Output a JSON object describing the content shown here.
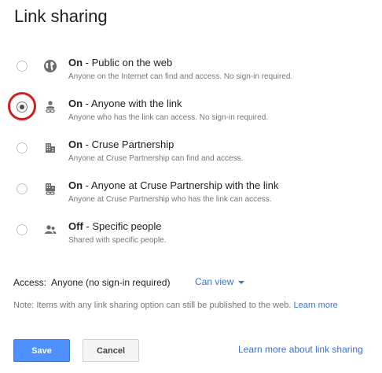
{
  "dialog": {
    "title": "Link sharing"
  },
  "options": [
    {
      "state": "On",
      "separator": " - ",
      "label": "Public on the web",
      "description": "Anyone on the Internet can find and access. No sign-in required.",
      "icon": "globe-icon",
      "selected": false
    },
    {
      "state": "On",
      "separator": " - ",
      "label": "Anyone with the link",
      "description": "Anyone who has the link can access. No sign-in required.",
      "icon": "person-link-icon",
      "selected": true
    },
    {
      "state": "On",
      "separator": " - ",
      "label": "Cruse Partnership",
      "description": "Anyone at Cruse Partnership can find and access.",
      "icon": "building-icon",
      "selected": false
    },
    {
      "state": "On",
      "separator": " - ",
      "label": "Anyone at Cruse Partnership with the link",
      "description": "Anyone at Cruse Partnership who has the link can access.",
      "icon": "building-link-icon",
      "selected": false
    },
    {
      "state": "Off",
      "separator": " - ",
      "label": "Specific people",
      "description": "Shared with specific people.",
      "icon": "people-icon",
      "selected": false
    }
  ],
  "access": {
    "label": "Access:",
    "value": "Anyone (no sign-in required)",
    "permission": "Can view"
  },
  "note": {
    "text": "Note: Items with any link sharing option can still be published to the web.",
    "link": "Learn more"
  },
  "buttons": {
    "save": "Save",
    "cancel": "Cancel"
  },
  "footer_link": "Learn more about link sharing",
  "colors": {
    "accent": "#4d90fe",
    "link": "#3a6fd8",
    "highlight_ring": "#d01f1f"
  }
}
